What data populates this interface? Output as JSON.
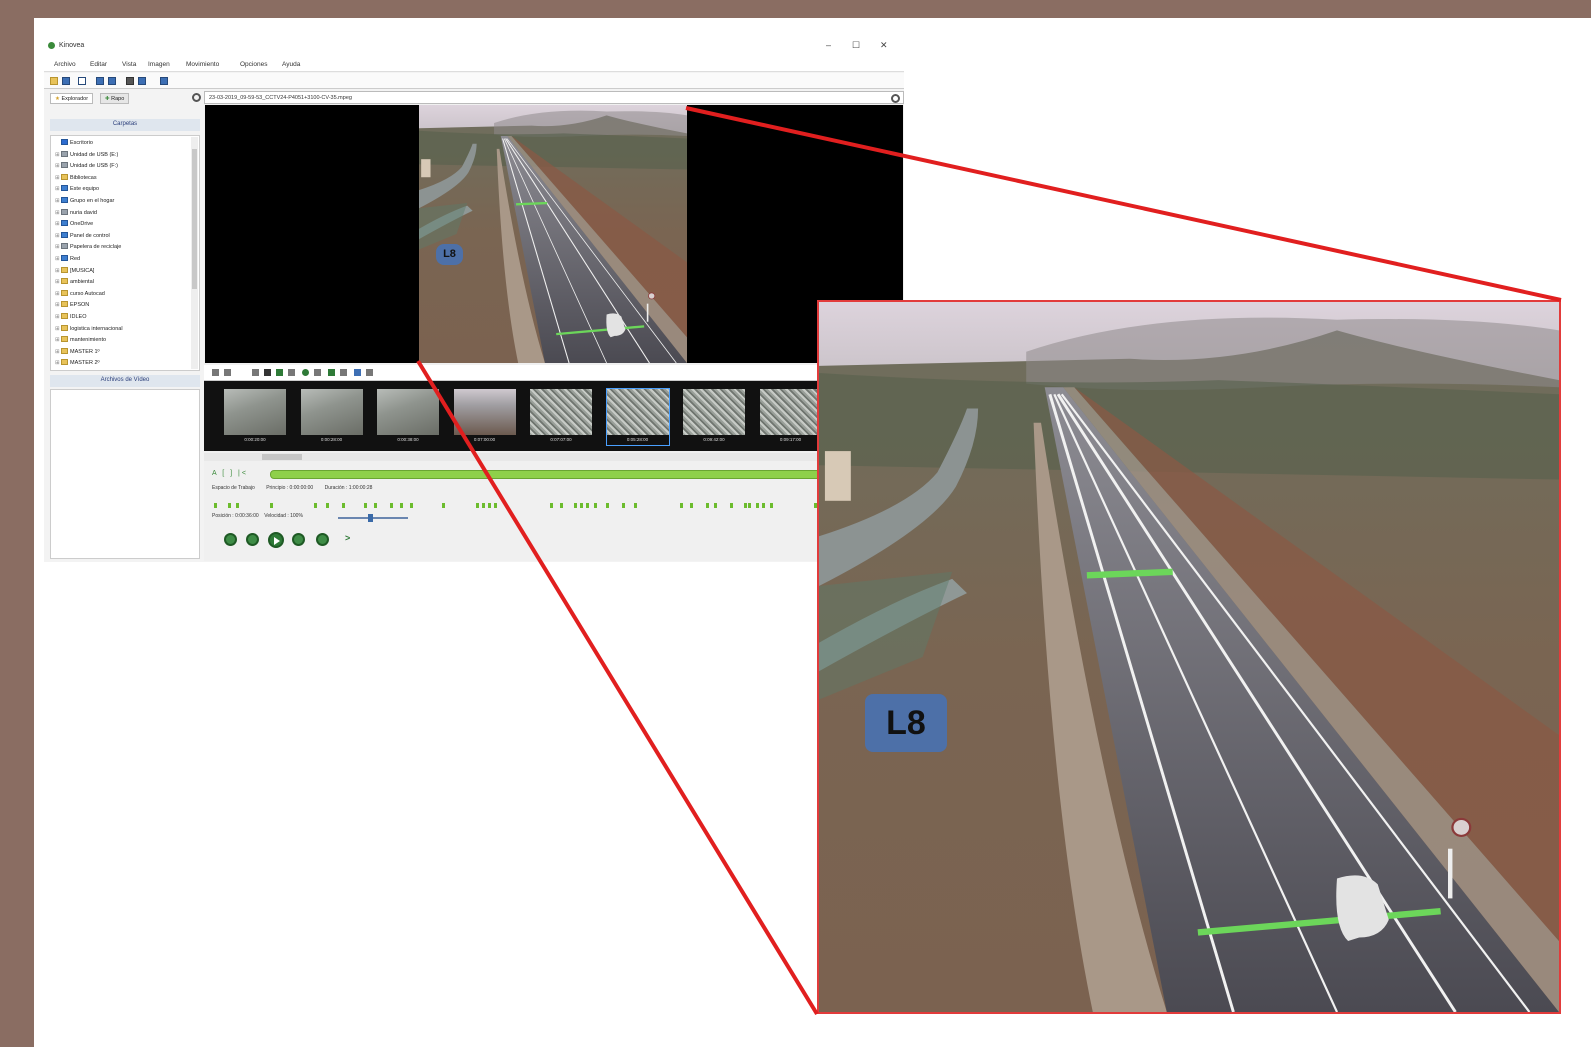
{
  "window": {
    "title": "Kinovea",
    "controls": {
      "minimize": "–",
      "maximize": "☐",
      "close": "✕"
    }
  },
  "menu": [
    "Archivo",
    "Editar",
    "Vista",
    "Imagen",
    "Movimiento",
    "Opciones",
    "Ayuda"
  ],
  "explorer": {
    "tabs": [
      "Explorador",
      "Rapo"
    ],
    "folders_header": "Carpetas",
    "tree": [
      {
        "label": "Escritorio",
        "icon": "desktop-icon"
      },
      {
        "label": "Unidad de USB (E:)",
        "icon": "drive-icon"
      },
      {
        "label": "Unidad de USB (F:)",
        "icon": "drive-icon"
      },
      {
        "label": "Bibliotecas",
        "icon": "folder-icon"
      },
      {
        "label": "Este equipo",
        "icon": "computer-icon"
      },
      {
        "label": "Grupo en el hogar",
        "icon": "homegroup-icon"
      },
      {
        "label": "nuria david",
        "icon": "user-icon"
      },
      {
        "label": "OneDrive",
        "icon": "cloud-icon"
      },
      {
        "label": "Panel de control",
        "icon": "control-panel-icon"
      },
      {
        "label": "Papelera de reciclaje",
        "icon": "recycle-bin-icon"
      },
      {
        "label": "Red",
        "icon": "network-icon"
      },
      {
        "label": "[MUSICA]",
        "icon": "folder-icon"
      },
      {
        "label": "ambiental",
        "icon": "folder-icon"
      },
      {
        "label": "curso Autocad",
        "icon": "folder-icon"
      },
      {
        "label": "EPSON",
        "icon": "folder-icon"
      },
      {
        "label": "IDLEO",
        "icon": "folder-icon"
      },
      {
        "label": "logistica internacional",
        "icon": "folder-icon"
      },
      {
        "label": "mantenimiento",
        "icon": "folder-icon"
      },
      {
        "label": "MASTER 1º",
        "icon": "folder-icon"
      },
      {
        "label": "MASTER 2º",
        "icon": "folder-icon"
      }
    ],
    "files_header": "Archivos de Vídeo"
  },
  "player": {
    "file_name": "23-03-2019_09-59-53_CCTV24-P4051+3100-CV-35.mpeg",
    "lane_label": "L8",
    "thumbnails": [
      "0:00:20:00",
      "0:00:28:00",
      "0:00:38:00",
      "0:07:00:00",
      "0:07:07:00",
      "0:05:28:00",
      "0:09:42:00",
      "0:09:17:00"
    ],
    "selected_thumbnail": 5,
    "mini_controls": "A [ ] |<",
    "info": {
      "workspace": "Espacio de Trabajo",
      "start": "Principio : 0:00:00:00",
      "duration": "Duración : 1:00:00:28"
    },
    "position": "Posición : 0:00:36:00",
    "speed": "Velocidad : 100%",
    "speed_value": 0.45,
    "play_end": ">"
  },
  "zoom": {
    "lane_label": "L8"
  },
  "colors": {
    "background": "#8a6d62",
    "zoom_border": "#e23b3b",
    "timeline": "#8ed04a",
    "lane_tag": "#4d70a8",
    "measure_line": "#6cd65a"
  }
}
